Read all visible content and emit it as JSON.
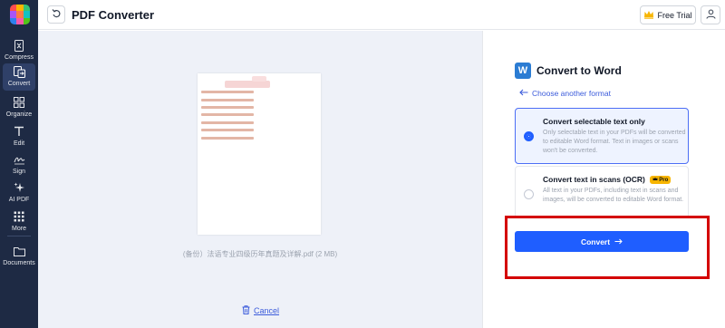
{
  "app": {
    "title": "PDF Converter"
  },
  "topbar": {
    "free_trial_label": "Free Trial"
  },
  "sidebar": {
    "items": [
      {
        "label": "Compress",
        "icon": "compress-icon"
      },
      {
        "label": "Convert",
        "icon": "convert-icon",
        "active": true
      },
      {
        "label": "Organize",
        "icon": "organize-icon"
      },
      {
        "label": "Edit",
        "icon": "text-edit-icon"
      },
      {
        "label": "Sign",
        "icon": "signature-icon"
      },
      {
        "label": "AI PDF",
        "icon": "sparkle-icon"
      },
      {
        "label": "More",
        "icon": "grid-dots-icon"
      },
      {
        "label": "Documents",
        "icon": "folder-icon"
      }
    ]
  },
  "preview": {
    "file_name": "(备份）法语专业四级历年真题及详解.pdf (2 MB)",
    "cancel_label": "Cancel"
  },
  "panel": {
    "title": "Convert to Word",
    "word_icon_letter": "W",
    "choose_format_label": "Choose another format",
    "options": [
      {
        "title": "Convert selectable text only",
        "description": "Only selectable text in your PDFs will be converted to editable Word format. Text in images or scans won't be converted.",
        "selected": true
      },
      {
        "title": "Convert text in scans (OCR)",
        "badge": "Pro",
        "description": "All text in your PDFs, including text in scans and images, will be converted to editable Word format.",
        "selected": false
      }
    ],
    "convert_label": "Convert"
  },
  "colors": {
    "sidebar_bg": "#1e2a44",
    "accent": "#1f5eff",
    "highlight": "#d40000",
    "preview_bg": "#eef1f8"
  }
}
